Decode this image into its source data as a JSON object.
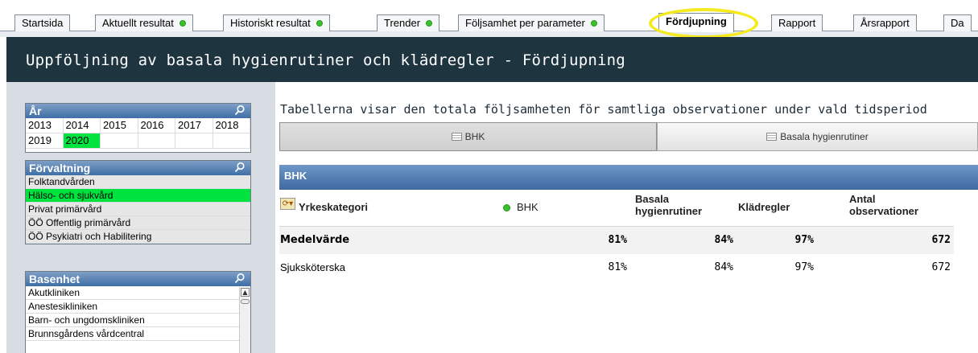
{
  "tabs": [
    {
      "label": "Startsida",
      "dot": false
    },
    {
      "label": "Aktuellt resultat",
      "dot": true
    },
    {
      "label": "Historiskt resultat",
      "dot": true
    },
    {
      "label": "Trender",
      "dot": true
    },
    {
      "label": "Följsamhet per parameter",
      "dot": true
    },
    {
      "label": "Fördjupning",
      "dot": false,
      "active": true
    },
    {
      "label": "Rapport",
      "dot": false
    },
    {
      "label": "Årsrapport",
      "dot": false
    },
    {
      "label": "Da",
      "dot": false
    }
  ],
  "header": {
    "title": "Uppföljning av basala hygienrutiner och klädregler - Fördjupning"
  },
  "year_box": {
    "caption": "År",
    "years": [
      "2013",
      "2014",
      "2015",
      "2016",
      "2017",
      "2018",
      "2019",
      "2020",
      "",
      "",
      "",
      ""
    ],
    "selected": "2020"
  },
  "forvaltning_box": {
    "caption": "Förvaltning",
    "items": [
      "Folktandvården",
      "Hälso- och sjukvård",
      "Privat primärvård",
      "ÖÖ Offentlig primärvård",
      "ÖÖ Psykiatri och Habilitering"
    ],
    "selected": "Hälso- och sjukvård"
  },
  "basenhet_box": {
    "caption": "Basenhet",
    "items": [
      "Akutkliniken",
      "Anestesikliniken",
      "Barn- och ungdomskliniken",
      "Brunnsgårdens vårdcentral"
    ]
  },
  "main": {
    "caption": "Tabellerna visar den totala följsamheten för samtliga observationer under vald tidsperiod",
    "buttons": [
      "BHK",
      "Basala hygienrutiner"
    ],
    "section_title": "BHK"
  },
  "table": {
    "headers": {
      "category": "Yrkeskategori",
      "bhk": "BHK",
      "basala": "Basala\nhygienrutiner",
      "kladregler": "Klädregler",
      "antal": "Antal\nobservationer"
    },
    "rows": [
      {
        "name": "Medelvärde",
        "bhk": "81%",
        "basala": "84%",
        "kladregler": "97%",
        "antal": "672"
      },
      {
        "name": "Sjuksköterska",
        "bhk": "81%",
        "basala": "84%",
        "kladregler": "97%",
        "antal": "672"
      }
    ]
  },
  "colors": {
    "header_bg": "#1e3540",
    "selected_green": "#00e23d",
    "caption_blue": "#3f6fa6",
    "highlight_yellow": "#f4ea1f"
  }
}
